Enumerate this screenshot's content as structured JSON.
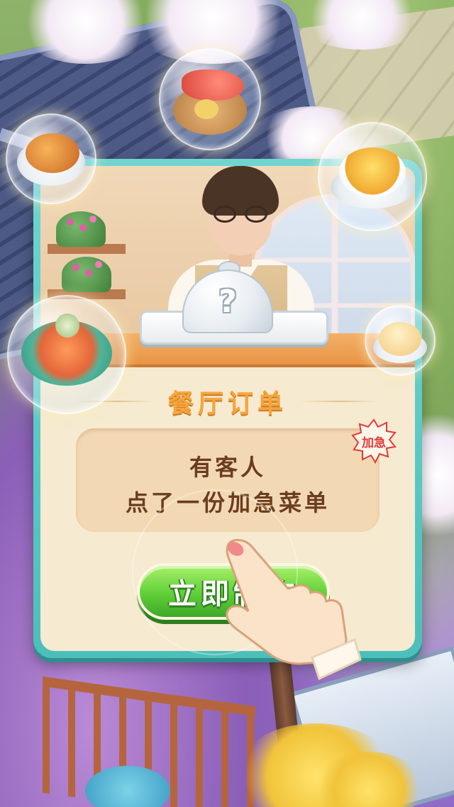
{
  "dialog": {
    "title": "餐厅订单",
    "message_line1": "有客人",
    "message_line2": "点了一份加急菜单",
    "urgent_badge": "加急",
    "action_button": "立即制作",
    "mystery_symbol": "?"
  },
  "dishes": [
    {
      "name": "roast-chicken",
      "icon": "roast-chicken-icon"
    },
    {
      "name": "steamed-fish-platter",
      "icon": "fish-platter-icon"
    },
    {
      "name": "corn-soup",
      "icon": "corn-soup-icon"
    },
    {
      "name": "seafood-hotpot",
      "icon": "hotpot-icon"
    },
    {
      "name": "pan-fried-bun",
      "icon": "bun-icon"
    }
  ],
  "colors": {
    "dialog_border": "#4cbfbb",
    "title": "#f6a53a",
    "message_text": "#6b3d1f",
    "button": "#5fcf36",
    "badge_text": "#e23a3a"
  }
}
